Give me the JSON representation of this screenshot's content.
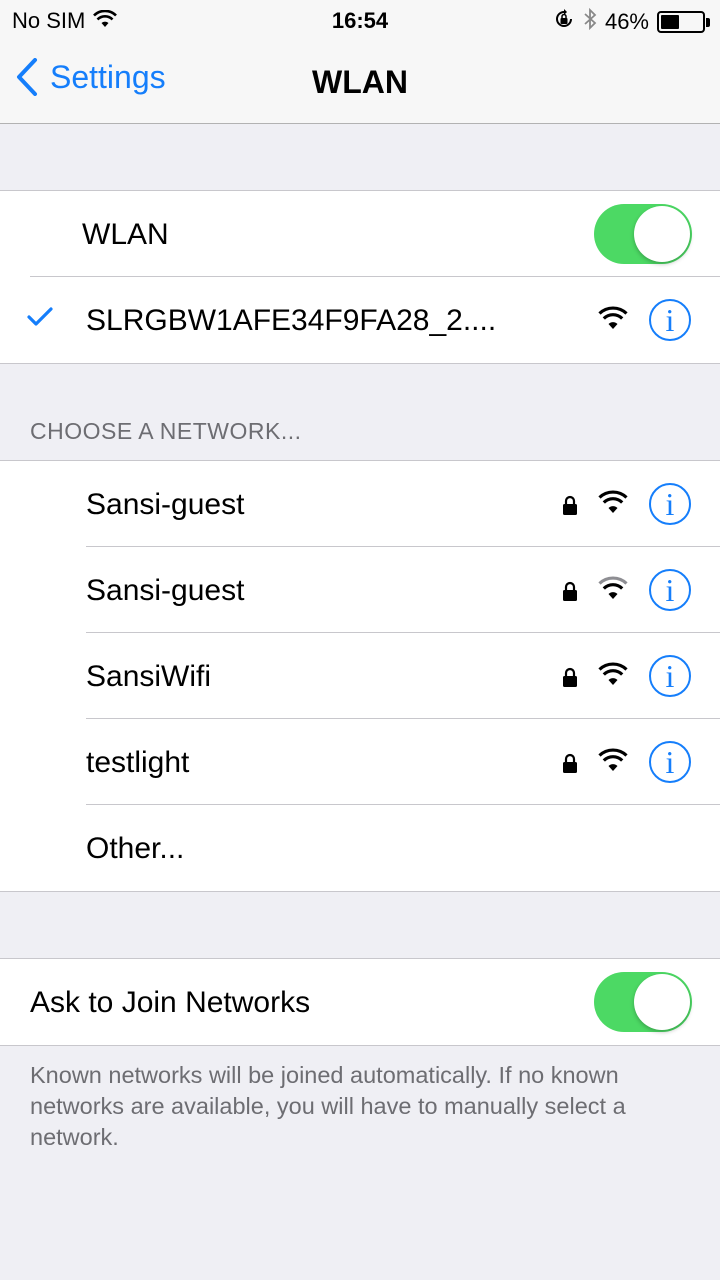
{
  "status_bar": {
    "carrier": "No SIM",
    "time": "16:54",
    "battery_percent": "46%",
    "battery_level": 0.46,
    "icons": [
      "wifi-icon",
      "orientation-lock-icon",
      "bluetooth-icon",
      "battery-icon"
    ]
  },
  "nav": {
    "back_label": "Settings",
    "title": "WLAN"
  },
  "wlan": {
    "label": "WLAN",
    "enabled": true
  },
  "connected_network": {
    "name": "SLRGBW1AFE34F9FA28_2....",
    "icons": [
      "checkmark-icon",
      "wifi-icon",
      "info-icon"
    ]
  },
  "choose_header": "CHOOSE A NETWORK...",
  "networks": [
    {
      "name": "Sansi-guest",
      "secured": true,
      "signal": "full"
    },
    {
      "name": "Sansi-guest",
      "secured": true,
      "signal": "weak"
    },
    {
      "name": "SansiWifi",
      "secured": true,
      "signal": "full"
    },
    {
      "name": "testlight",
      "secured": true,
      "signal": "full"
    }
  ],
  "other_label": "Other...",
  "ask_to_join": {
    "label": "Ask to Join Networks",
    "enabled": true
  },
  "footer_note": "Known networks will be joined automatically. If no known networks are available, you will have to manually select a network.",
  "colors": {
    "accent": "#157efb",
    "toggle_on": "#4cd964",
    "background": "#efeff4",
    "weak_signal": "#8e8e93"
  }
}
